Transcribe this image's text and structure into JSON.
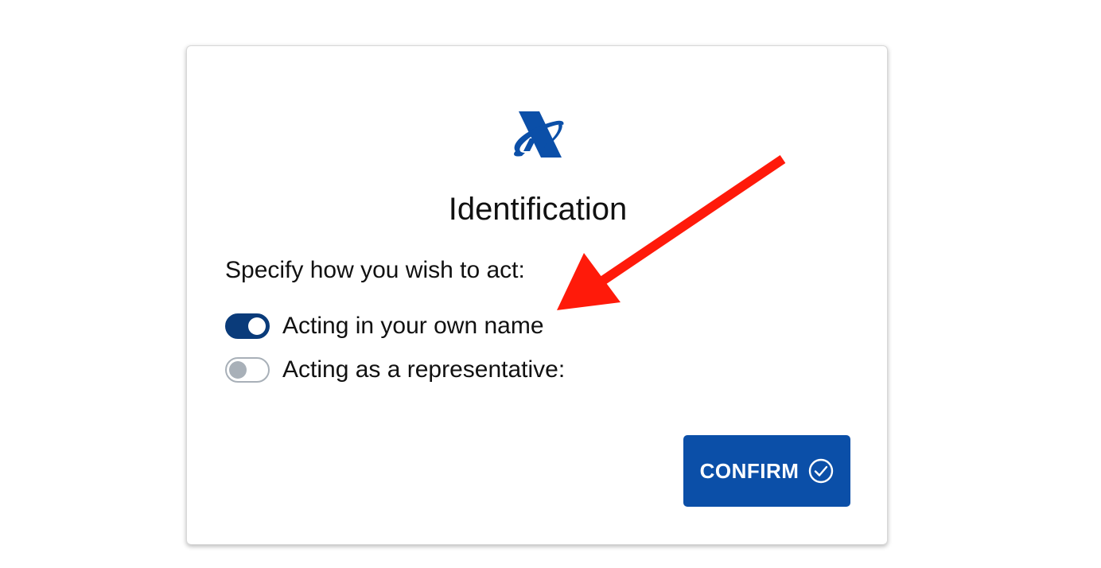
{
  "dialog": {
    "logo_icon": "agency-logo-icon",
    "title": "Identification",
    "prompt": "Specify how you wish to act:",
    "options": [
      {
        "label": "Acting in your own name",
        "selected": true
      },
      {
        "label": "Acting as a representative:",
        "selected": false
      }
    ],
    "confirm_label": "CONFIRM",
    "confirm_icon": "check-circle-icon"
  },
  "annotation": {
    "icon": "red-arrow-icon",
    "color": "#ff1a0a"
  },
  "colors": {
    "primary_button": "#0b4fa8",
    "toggle_on": "#0a3b7a",
    "toggle_off": "#a8b0b8",
    "logo": "#0b4fa8"
  }
}
